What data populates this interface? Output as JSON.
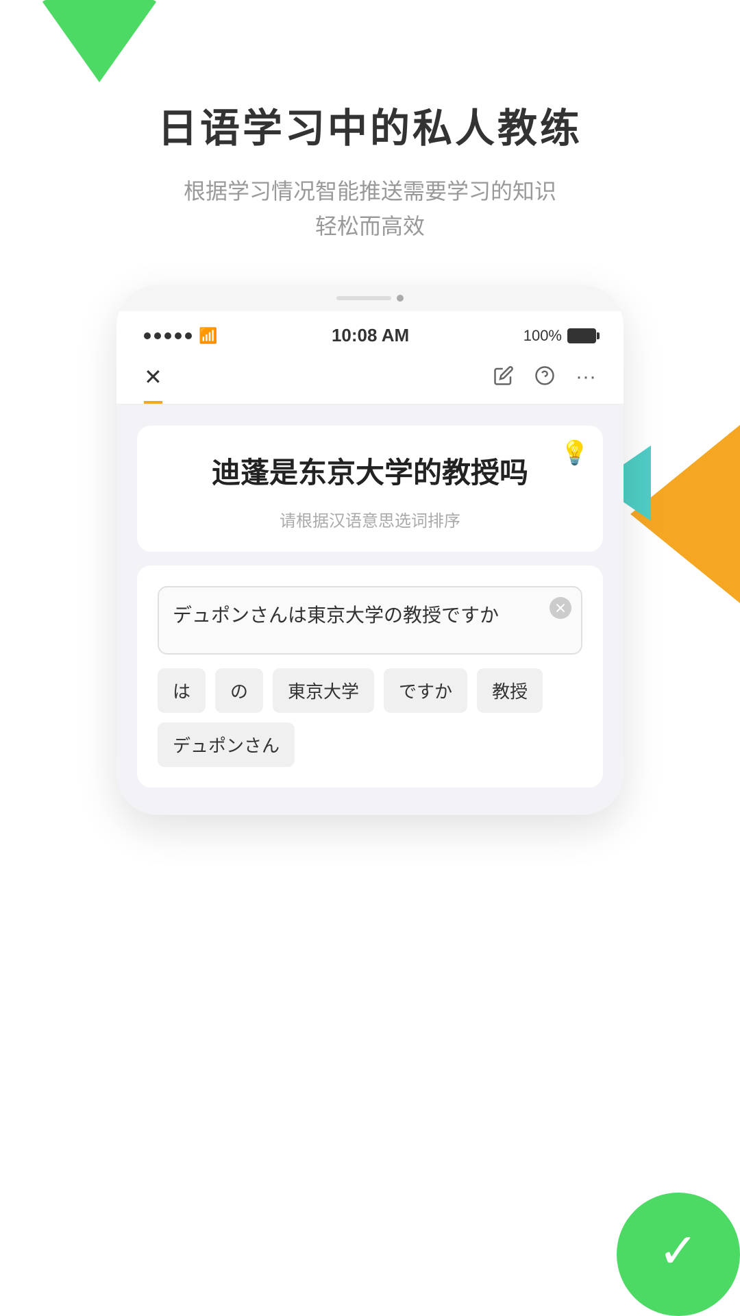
{
  "app": {
    "hero": {
      "title": "日语学习中的私人教练",
      "subtitle_line1": "根据学习情况智能推送需要学习的知识",
      "subtitle_line2": "轻松而高效"
    },
    "decorations": {
      "top_triangle_color": "#4cd964",
      "right_orange_color": "#f5a623",
      "right_teal_color": "#4ecdc4",
      "bottom_green_color": "#4cd964"
    },
    "phone": {
      "status_bar": {
        "time": "10:08 AM",
        "battery": "100%"
      },
      "nav": {
        "close_label": "✕",
        "icon_edit": "✎",
        "icon_help": "?",
        "icon_more": "···"
      },
      "question_card": {
        "bulb": "💡",
        "text": "迪蓬是东京大学的教授吗",
        "hint": "请根据汉语意思选词排序"
      },
      "answer_card": {
        "input_text": "デュポンさんは東京大学の教授ですか",
        "chips": [
          {
            "id": "chip1",
            "label": "は"
          },
          {
            "id": "chip2",
            "label": "の"
          },
          {
            "id": "chip3",
            "label": "東京大学"
          },
          {
            "id": "chip4",
            "label": "ですか"
          },
          {
            "id": "chip5",
            "label": "教授"
          },
          {
            "id": "chip6",
            "label": "デュポンさん"
          }
        ]
      }
    }
  }
}
